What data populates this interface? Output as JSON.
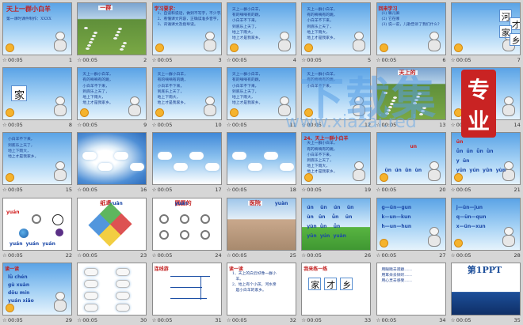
{
  "duration": "00:05",
  "star": "☆",
  "slides": [
    {
      "n": "1",
      "bg": "sky",
      "title": "天上一群小白羊",
      "sub": "第一课时课件制作：XXXX"
    },
    {
      "n": "2",
      "bg": "field",
      "label": "一群"
    },
    {
      "n": "3",
      "bg": "sky",
      "head": "学习要求：",
      "lines": [
        "1、自读和说话，做到不写字，不少字。",
        "2、看懂课文内容，正确读准多音字，",
        "3、背诵课文及指导读。"
      ]
    },
    {
      "n": "4",
      "bg": "sky",
      "lines": [
        "天上一群小白羊，",
        "有的嘀嘀有的跳，",
        "小白羊不下来，",
        "到底乐上天了，",
        "地上下雨大，",
        "地上才是我家乡。"
      ]
    },
    {
      "n": "5",
      "bg": "sky",
      "lines": [
        "天上一群小白羊，",
        "有的嘀嘀有的跳，",
        "小白羊不下来，",
        "到底乐上天了，",
        "地上下雨大，",
        "地上才是我家乡。"
      ]
    },
    {
      "n": "6",
      "bg": "sky",
      "head": "回来学习",
      "lines": [
        "(1) 嘛儿嘛",
        "(2) 它在哪",
        "(3) 说一说，儿歌告诉了我们什么？"
      ]
    },
    {
      "n": "7",
      "bg": "sky",
      "chars": [
        "河",
        "才",
        "家",
        "乡"
      ]
    },
    {
      "n": "8",
      "bg": "sky",
      "char": "家"
    },
    {
      "n": "9",
      "bg": "sky",
      "lines": [
        "天上一群小白羊，",
        "有的嘀嘀有的跳，",
        "小白羊不下来，",
        "到底乐上天了，",
        "地上下雨大，",
        "地上才是我家乡。"
      ]
    },
    {
      "n": "10",
      "bg": "sky",
      "lines": [
        "天上一群小白羊，",
        "有的嘀嘀有的跳，",
        "小白羊不下来，",
        "到底乐上天了，",
        "地上下雨大，",
        "地上才是我家乡。"
      ]
    },
    {
      "n": "11",
      "bg": "sky",
      "lines": [
        "天上一群小白羊，",
        "有的嘀嘀有的跳，",
        "小白羊不下来，",
        "到底乐上天了，",
        "地上下雨大，",
        "地上才是我家乡。"
      ]
    },
    {
      "n": "12",
      "bg": "sky",
      "lines": [
        "天上一群小白羊，",
        "有的嘀嘀有的跳，",
        "小白羊不下来，"
      ]
    },
    {
      "n": "13",
      "bg": "field",
      "label": "天上的"
    },
    {
      "n": "14",
      "bg": "sky",
      "lines": []
    },
    {
      "n": "15",
      "bg": "sky",
      "lines": [
        "小白羊不下来，",
        "到底乐上天了，",
        "地上下雨大，",
        "地上才是我家乡。"
      ]
    },
    {
      "n": "16",
      "bg": "clouds"
    },
    {
      "n": "17",
      "bg": "sky2"
    },
    {
      "n": "18",
      "bg": "sky2"
    },
    {
      "n": "19",
      "bg": "sky",
      "head": "24、天上一群小白羊",
      "lines": [
        "天上一群小白羊，",
        "有的嘀嘀有的跳，",
        "小白羊不下来，",
        "到底乐上天了，",
        "地上下雨大，",
        "地上才是我家乡。"
      ]
    },
    {
      "n": "20",
      "bg": "sky",
      "pinyin": [
        "un",
        "ūn  ún  ǔn  ùn"
      ]
    },
    {
      "n": "21",
      "bg": "sky",
      "pinyin": [
        "ün",
        "ǖn  ǘn  ǚn  ǜn",
        "y  ün",
        "yūn  yún  yǔn  yùn"
      ]
    },
    {
      "n": "22",
      "bg": "white",
      "pinyin": [
        "yuán",
        "yuán  yuán  yuán"
      ]
    },
    {
      "n": "23",
      "bg": "white",
      "label": "纸鸢",
      "pinyin": [
        "yuān"
      ]
    },
    {
      "n": "24",
      "bg": "white",
      "label": "圆圆的",
      "pinyin": [
        "yuán"
      ]
    },
    {
      "n": "25",
      "bg": "building",
      "label": "医院",
      "pinyin": [
        "yuàn"
      ]
    },
    {
      "n": "26",
      "bg": "green",
      "pinyin": [
        "ún    ūn    ún    ūn",
        "ùn   ūn    ǚn    ün",
        "yùn  ǜn    ǚn",
        "yūn  yún  yuàn"
      ]
    },
    {
      "n": "27",
      "bg": "sky",
      "pinyin": [
        "g—ün—gun",
        "k—un—kun",
        "h—un—hun"
      ]
    },
    {
      "n": "28",
      "bg": "sky",
      "pinyin": [
        "j—ün—jun",
        "q—ün—qun",
        "x—ün—xun"
      ]
    },
    {
      "n": "29",
      "bg": "sky",
      "head": "读一读",
      "pinyin": [
        "lǜ chén",
        "gù xuàn",
        "dōu mín",
        "yuán xiǎo"
      ]
    },
    {
      "n": "30",
      "bg": "white"
    },
    {
      "n": "31",
      "bg": "white",
      "head": "连线游"
    },
    {
      "n": "32",
      "bg": "white",
      "head": "读一读",
      "lines": [
        "1、天上的白云好像一群小",
        "   羊。",
        "2、地上有个小孩，河水亲",
        "   是小白羊的家乡。"
      ]
    },
    {
      "n": "33",
      "bg": "white",
      "head": "我来练一练",
      "chars": [
        "家",
        "才",
        "乡"
      ]
    },
    {
      "n": "34",
      "bg": "white",
      "lines": [
        "用眼睛去观察……",
        "用耳朵去倾听……",
        "用心灵去感受……"
      ]
    },
    {
      "n": "35",
      "bg": "ppt",
      "label": "第1PPT"
    }
  ],
  "watermark": {
    "text": "下载集",
    "url": "www.xiazai.red",
    "badge": [
      "专",
      "业"
    ]
  },
  "colors": {
    "sorter_bg": "#d6d6d6",
    "text_blue": "#1a3d8c",
    "title_red": "#c21d1d"
  }
}
